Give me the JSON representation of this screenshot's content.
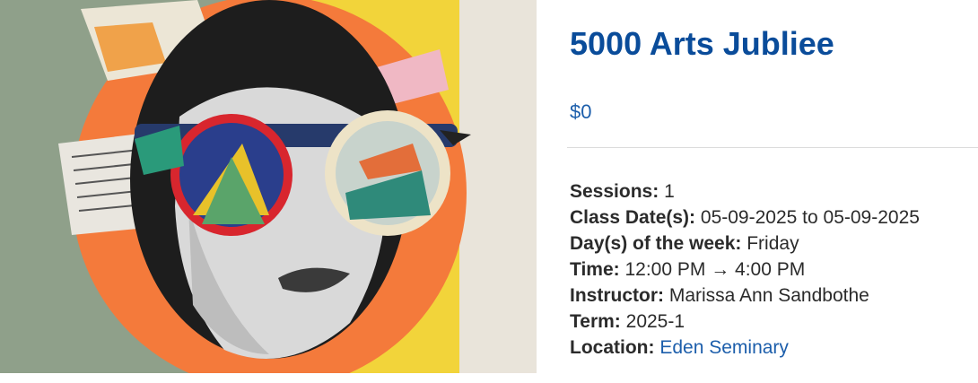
{
  "event": {
    "title": "5000 Arts Jubliee",
    "price": "$0",
    "image_alt": "Pop-art collage portrait of a woman wearing oversized colorful sunglasses"
  },
  "details": {
    "sessions_label": "Sessions:",
    "sessions_value": "1",
    "dates_label": "Class Date(s):",
    "dates_value": "05-09-2025 to 05-09-2025",
    "days_label": "Day(s) of the week:",
    "days_value": "Friday",
    "time_label": "Time:",
    "time_value": "12:00 PM → 4:00 PM",
    "instructor_label": "Instructor:",
    "instructor_value": "Marissa Ann Sandbothe",
    "term_label": "Term:",
    "term_value": "2025-1",
    "location_label": "Location:",
    "location_value": "Eden Seminary"
  },
  "colors": {
    "title": "#0a4c9a",
    "link": "#1c5eab",
    "hero_orange": "#f47a3b",
    "hero_yellow": "#f2d43a",
    "hero_sage": "#8fa08a"
  }
}
